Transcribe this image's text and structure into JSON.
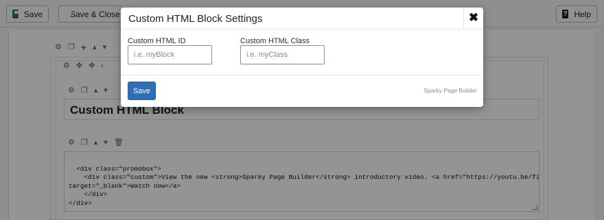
{
  "toolbar": {
    "save_label": "Save",
    "save_close_label": "Save & Close",
    "help_label": "Help"
  },
  "editor": {
    "block_title": "Custom HTML Block",
    "code": "<div class=\"promobox\">\n    <div class=\"custom\">View the new <strong>Sparky Page Builder</strong> introductory video. <a href=\"https://youtu.be/figNI_usUMk\"\ntarget=\"_blank\">Watch now</a>\n    </div>\n</div>"
  },
  "modal": {
    "title": "Custom HTML Block Settings",
    "close_glyph": "✖",
    "id_label": "Custom HTML ID",
    "id_placeholder": "i.e. myBlock",
    "id_value": "",
    "class_label": "Custom HTML Class",
    "class_placeholder": "i.e. myClass",
    "class_value": "",
    "save_label": "Save",
    "brand": "Sparky Page Builder"
  },
  "colors": {
    "primary_button": "#2f6fb8",
    "save_icon": "#2a7a3a",
    "overlay": "rgba(0,0,0,0.42)"
  }
}
